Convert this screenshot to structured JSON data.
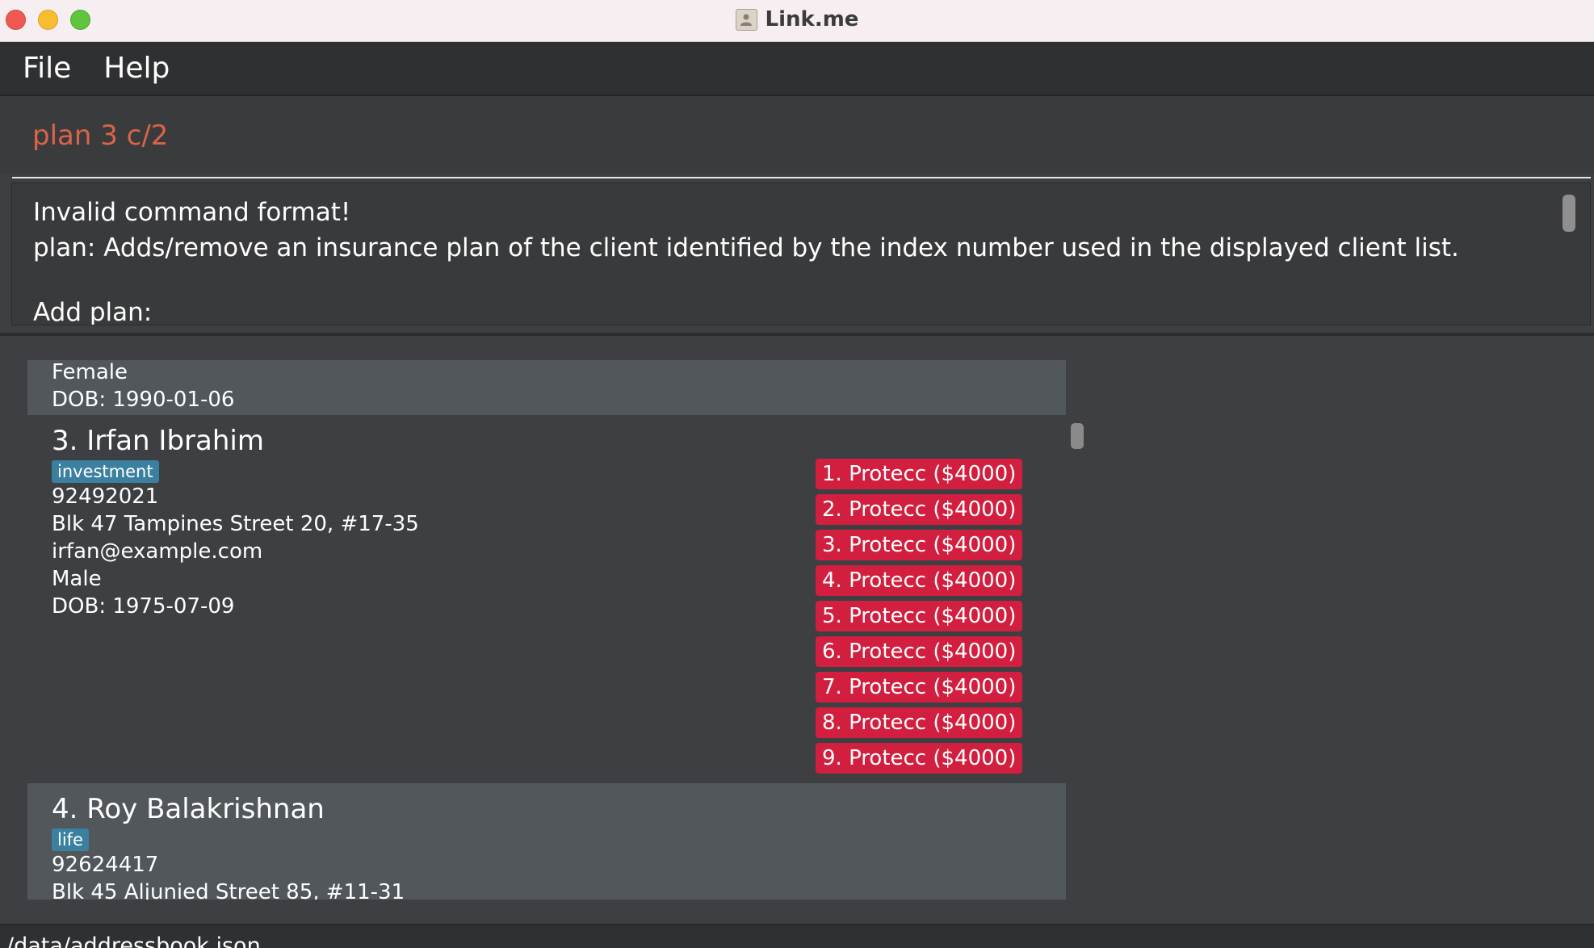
{
  "window": {
    "title": "Link.me",
    "app_icon": "address-book-icon"
  },
  "menu": {
    "items": [
      "File",
      "Help"
    ]
  },
  "command": {
    "value": "plan 3 c/2"
  },
  "result": {
    "lines": [
      "Invalid command format!",
      "plan: Adds/remove an insurance plan of the client identified by the index number used in the displayed client list.",
      "Add plan:"
    ]
  },
  "clients": {
    "partial_top": {
      "gender": "Female",
      "dob": "DOB: 1990-01-06"
    },
    "client3": {
      "name": "3.  Irfan Ibrahim",
      "tag": "investment",
      "phone": "92492021",
      "address": "Blk 47 Tampines Street 20, #17-35",
      "email": "irfan@example.com",
      "gender": "Male",
      "dob": "DOB: 1975-07-09",
      "plans": [
        "1. Protecc ($4000)",
        "2. Protecc ($4000)",
        "3. Protecc ($4000)",
        "4. Protecc ($4000)",
        "5. Protecc ($4000)",
        "6. Protecc ($4000)",
        "7. Protecc ($4000)",
        "8. Protecc ($4000)",
        "9. Protecc ($4000)"
      ]
    },
    "client4": {
      "name": "4.  Roy Balakrishnan",
      "tag": "life",
      "phone": "92624417",
      "address": "Blk 45 Aljunied Street 85, #11-31"
    }
  },
  "status": {
    "path": "/data/addressbook.json"
  },
  "colors": {
    "command_text": "#d9644a",
    "plan_badge": "#d21f3f",
    "tag_badge": "#3b80a0"
  }
}
